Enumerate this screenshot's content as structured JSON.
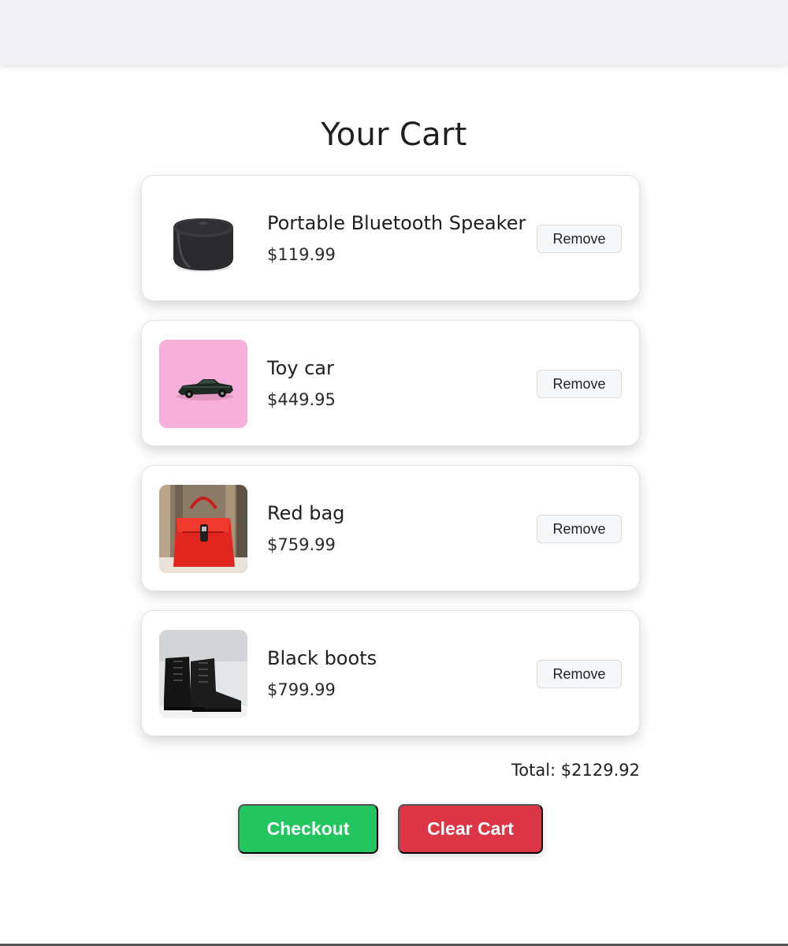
{
  "cart": {
    "title": "Your Cart",
    "items": [
      {
        "name": "Portable Bluetooth Speaker",
        "price": "$119.99",
        "remove_label": "Remove",
        "image": "speaker"
      },
      {
        "name": "Toy car",
        "price": "$449.95",
        "remove_label": "Remove",
        "image": "toy-car"
      },
      {
        "name": "Red bag",
        "price": "$759.99",
        "remove_label": "Remove",
        "image": "red-bag"
      },
      {
        "name": "Black boots",
        "price": "$799.99",
        "remove_label": "Remove",
        "image": "black-boots"
      }
    ],
    "total": "Total: $2129.92",
    "checkout_label": "Checkout",
    "clear_label": "Clear Cart"
  },
  "colors": {
    "checkout": "#22c55e",
    "clear": "#dc3545",
    "topbar": "#f2f2f5"
  }
}
